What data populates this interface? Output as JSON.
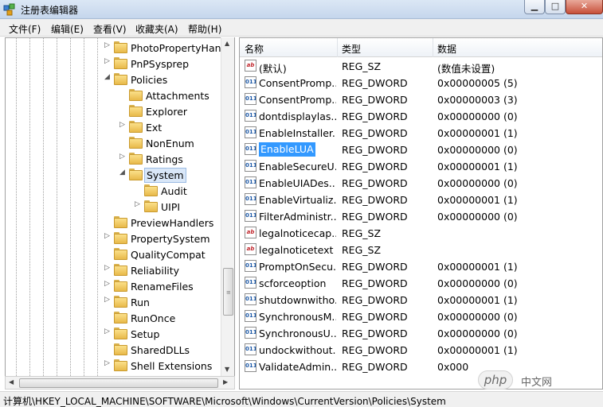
{
  "window": {
    "title": "注册表编辑器",
    "controls": {
      "minimize": "▁",
      "maximize": "□",
      "close": "✕"
    }
  },
  "menu": [
    "文件(F)",
    "编辑(E)",
    "查看(V)",
    "收藏夹(A)",
    "帮助(H)"
  ],
  "tree": [
    {
      "label": "PhotoPropertyHand",
      "toggle": "▷"
    },
    {
      "label": "PnPSysprep",
      "toggle": "▷"
    },
    {
      "label": "Policies",
      "toggle": "◢"
    },
    {
      "label": "Attachments",
      "toggle": ""
    },
    {
      "label": "Explorer",
      "toggle": ""
    },
    {
      "label": "Ext",
      "toggle": "▷"
    },
    {
      "label": "NonEnum",
      "toggle": ""
    },
    {
      "label": "Ratings",
      "toggle": "▷"
    },
    {
      "label": "System",
      "toggle": "◢",
      "selected": true
    },
    {
      "label": "Audit",
      "toggle": ""
    },
    {
      "label": "UIPI",
      "toggle": "▷"
    },
    {
      "label": "PreviewHandlers",
      "toggle": ""
    },
    {
      "label": "PropertySystem",
      "toggle": "▷"
    },
    {
      "label": "QualityCompat",
      "toggle": ""
    },
    {
      "label": "Reliability",
      "toggle": "▷"
    },
    {
      "label": "RenameFiles",
      "toggle": "▷"
    },
    {
      "label": "Run",
      "toggle": "▷"
    },
    {
      "label": "RunOnce",
      "toggle": ""
    },
    {
      "label": "Setup",
      "toggle": "▷"
    },
    {
      "label": "SharedDLLs",
      "toggle": ""
    },
    {
      "label": "Shell Extensions",
      "toggle": "▷"
    }
  ],
  "columns": {
    "name": "名称",
    "type": "类型",
    "data": "数据"
  },
  "values": [
    {
      "icon": "sz",
      "name": "(默认)",
      "type": "REG_SZ",
      "data": "(数值未设置)"
    },
    {
      "icon": "dword",
      "name": "ConsentPromp...",
      "type": "REG_DWORD",
      "data": "0x00000005 (5)"
    },
    {
      "icon": "dword",
      "name": "ConsentPromp...",
      "type": "REG_DWORD",
      "data": "0x00000003 (3)"
    },
    {
      "icon": "dword",
      "name": "dontdisplaylas...",
      "type": "REG_DWORD",
      "data": "0x00000000 (0)"
    },
    {
      "icon": "dword",
      "name": "EnableInstaller...",
      "type": "REG_DWORD",
      "data": "0x00000001 (1)"
    },
    {
      "icon": "dword",
      "name": "EnableLUA",
      "type": "REG_DWORD",
      "data": "0x00000000 (0)",
      "selected": true
    },
    {
      "icon": "dword",
      "name": "EnableSecureU...",
      "type": "REG_DWORD",
      "data": "0x00000001 (1)"
    },
    {
      "icon": "dword",
      "name": "EnableUIADes...",
      "type": "REG_DWORD",
      "data": "0x00000000 (0)"
    },
    {
      "icon": "dword",
      "name": "EnableVirtualiz...",
      "type": "REG_DWORD",
      "data": "0x00000001 (1)"
    },
    {
      "icon": "dword",
      "name": "FilterAdministr...",
      "type": "REG_DWORD",
      "data": "0x00000000 (0)"
    },
    {
      "icon": "sz",
      "name": "legalnoticecap...",
      "type": "REG_SZ",
      "data": ""
    },
    {
      "icon": "sz",
      "name": "legalnoticetext",
      "type": "REG_SZ",
      "data": ""
    },
    {
      "icon": "dword",
      "name": "PromptOnSecu...",
      "type": "REG_DWORD",
      "data": "0x00000001 (1)"
    },
    {
      "icon": "dword",
      "name": "scforceoption",
      "type": "REG_DWORD",
      "data": "0x00000000 (0)"
    },
    {
      "icon": "dword",
      "name": "shutdownwitho...",
      "type": "REG_DWORD",
      "data": "0x00000001 (1)"
    },
    {
      "icon": "dword",
      "name": "SynchronousM...",
      "type": "REG_DWORD",
      "data": "0x00000000 (0)"
    },
    {
      "icon": "dword",
      "name": "SynchronousU...",
      "type": "REG_DWORD",
      "data": "0x00000000 (0)"
    },
    {
      "icon": "dword",
      "name": "undockwithout...",
      "type": "REG_DWORD",
      "data": "0x00000001 (1)"
    },
    {
      "icon": "dword",
      "name": "ValidateAdmin...",
      "type": "REG_DWORD",
      "data": "0x000"
    }
  ],
  "icon_text": {
    "sz": "ab",
    "dword": "011"
  },
  "watermark": {
    "logo": "php",
    "text": "中文网"
  },
  "statusbar": {
    "path": "计算机\\HKEY_LOCAL_MACHINE\\SOFTWARE\\Microsoft\\Windows\\CurrentVersion\\Policies\\System"
  }
}
